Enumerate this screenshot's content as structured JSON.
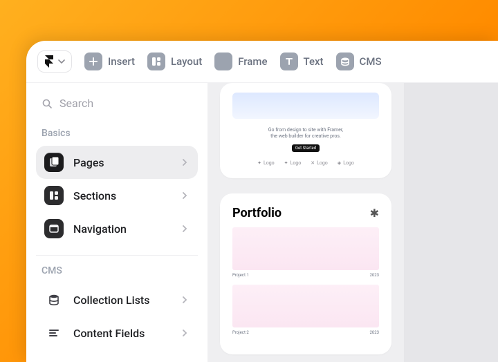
{
  "toolbar": {
    "insert": "Insert",
    "layout": "Layout",
    "frame": "Frame",
    "text": "Text",
    "cms": "CMS"
  },
  "search": {
    "placeholder": "Search"
  },
  "sections": {
    "basics_label": "Basics",
    "cms_label": "CMS",
    "basics": [
      {
        "label": "Pages"
      },
      {
        "label": "Sections"
      },
      {
        "label": "Navigation"
      }
    ],
    "cms": [
      {
        "label": "Collection Lists"
      },
      {
        "label": "Content Fields"
      }
    ]
  },
  "preview": {
    "hero_line1": "Go from design to site with Framer,",
    "hero_line2": "the web builder for creative pros.",
    "hero_cta": "Get Started",
    "logos": [
      "Logo",
      "Logo",
      "Logo",
      "Logo"
    ],
    "portfolio_title": "Portfolio",
    "projects": [
      {
        "name": "Project 1",
        "year": "2023"
      },
      {
        "name": "Project 2",
        "year": "2023"
      }
    ]
  }
}
